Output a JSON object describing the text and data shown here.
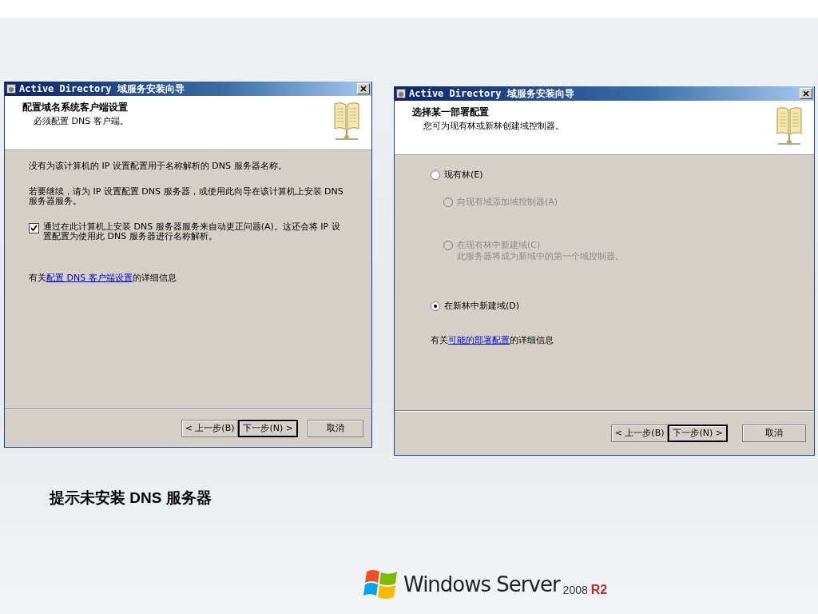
{
  "slide": {
    "windows": [
      {
        "title": "Active Directory 域服务安装向导",
        "header_title": "配置域名系统客户端设置",
        "header_subtitle": "必须配置 DNS 客户端。",
        "body": [
          {
            "kind": "text",
            "text": "没有为该计算机的 IP 设置配置用于名称解析的 DNS 服务器名称。"
          },
          {
            "kind": "text",
            "text": "若要继续，请为 IP 设置配置 DNS 服务器，或使用此向导在该计算机上安装 DNS 服务器服务。"
          },
          {
            "kind": "checkbox",
            "label": "通过在此计算机上安装 DNS 服务器服务来自动更正问题(A)。这还会将 IP 设置配置为使用此 DNS 服务器进行名称解析。",
            "checked": true
          },
          {
            "kind": "link",
            "prefix": "有关",
            "link": "配置 DNS 客户端设置",
            "suffix": "的详细信息"
          }
        ],
        "buttons": [
          {
            "label": "< 上一步(B)",
            "default": false
          },
          {
            "label": "下一步(N) >",
            "default": true
          },
          {
            "label": "取消",
            "default": false
          }
        ]
      },
      {
        "title": "Active Directory 域服务安装向导",
        "header_title": "选择某一部署配置",
        "header_subtitle": "您可为现有林或新林创建域控制器。",
        "body": [
          {
            "kind": "radio",
            "label": "现有林(E)",
            "selected": false,
            "disabled": false,
            "children": [
              {
                "label": "向现有域添加域控制器(A)",
                "selected": false,
                "disabled": true
              },
              {
                "label": "在现有林中新建域(C)",
                "description": "此服务器将成为新域中的第一个域控制器。",
                "selected": false,
                "disabled": true
              }
            ]
          },
          {
            "kind": "radio",
            "label": "在新林中新建域(D)",
            "selected": true,
            "disabled": false
          },
          {
            "kind": "link",
            "prefix": "有关",
            "link": "可能的部署配置",
            "suffix": "的详细信息"
          }
        ],
        "buttons": [
          {
            "label": "< 上一步(B)",
            "default": false
          },
          {
            "label": "下一步(N) >",
            "default": true
          },
          {
            "label": "取消",
            "default": false
          }
        ]
      }
    ],
    "caption": "提示未安装 DNS 服务器",
    "logo": {
      "name": "Windows Server",
      "year": "2008",
      "edition": "R2"
    }
  }
}
